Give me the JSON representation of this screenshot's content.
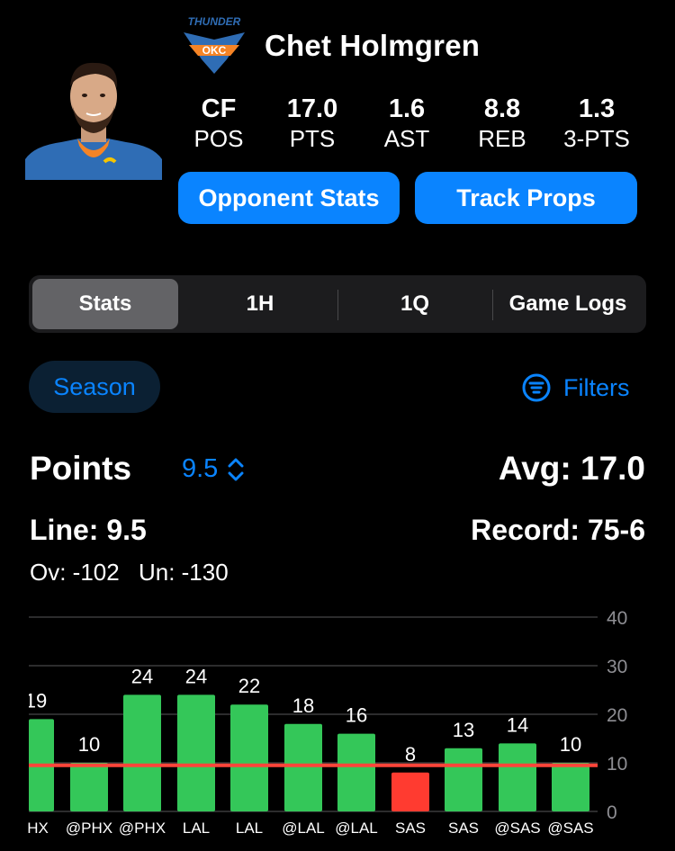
{
  "player": {
    "name": "Chet Holmgren",
    "team_logo_text": "THUNDER",
    "team_logo_abbr": "OKC"
  },
  "summary": [
    {
      "value": "CF",
      "label": "POS"
    },
    {
      "value": "17.0",
      "label": "PTS"
    },
    {
      "value": "1.6",
      "label": "AST"
    },
    {
      "value": "8.8",
      "label": "REB"
    },
    {
      "value": "1.3",
      "label": "3-PTS"
    }
  ],
  "actions": {
    "opponent_stats": "Opponent Stats",
    "track_props": "Track Props"
  },
  "tabs": [
    "Stats",
    "1H",
    "1Q",
    "Game Logs"
  ],
  "active_tab": "Stats",
  "filters": {
    "season_label": "Season",
    "filters_label": "Filters",
    "filters_icon": "filter-circle-icon"
  },
  "prop": {
    "title": "Points",
    "line_select": "9.5",
    "avg": "Avg: 17.0",
    "line": "Line: 9.5",
    "record": "Record: 75-6",
    "over": "Ov: -102",
    "under": "Un: -130"
  },
  "colors": {
    "accent": "#0a84ff",
    "over_bar": "#34c759",
    "under_bar": "#ff3b30",
    "line": "#ff453a"
  },
  "chart_data": {
    "type": "bar",
    "categories": [
      "@PHX",
      "@PHX",
      "@PHX",
      "LAL",
      "LAL",
      "@LAL",
      "@LAL",
      "SAS",
      "SAS",
      "@SAS",
      "@SAS"
    ],
    "category_labels_shown": [
      "HX",
      "@PHX",
      "@PHX",
      "LAL",
      "LAL",
      "@LAL",
      "@LAL",
      "SAS",
      "SAS",
      "@SAS",
      "@SAS"
    ],
    "values": [
      19,
      10,
      24,
      24,
      22,
      18,
      16,
      8,
      13,
      14,
      10
    ],
    "value_labels_shown": [
      "19",
      "10",
      "24",
      "24",
      "22",
      "18",
      "16",
      "8",
      "13",
      "14",
      "10"
    ],
    "reference_line": 9.5,
    "ylim": [
      0,
      40
    ],
    "yticks": [
      0,
      10,
      20,
      30,
      40
    ],
    "grid": true,
    "title": "",
    "xlabel": "",
    "ylabel": ""
  }
}
